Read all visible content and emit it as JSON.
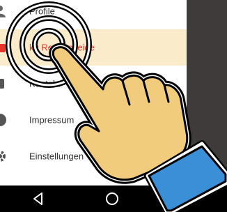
{
  "drawer": {
    "items": [
      {
        "label": "Profile",
        "icon": "profile-icon",
        "active": false
      },
      {
        "label": "kg Rest Anzeige",
        "icon": "scale-icon",
        "active": true
      },
      {
        "label": "Kontakt",
        "icon": "contact-icon",
        "active": false
      },
      {
        "label": "Impressum",
        "icon": "info-icon",
        "active": false
      },
      {
        "label": "Einstellungen",
        "icon": "gear-icon",
        "active": false
      }
    ]
  },
  "navbar": {
    "buttons": [
      "back-icon",
      "home-icon",
      "recents-icon"
    ]
  },
  "colors": {
    "active_bg": "#faeccb",
    "active_text": "#e8332a",
    "text": "#333333",
    "hand_fill": "#f0cc7c",
    "cuff": "#3b8fd6",
    "navbar": "#000000",
    "backdrop": "#3f3b3a"
  },
  "overlay": {
    "gesture": "tap-gesture",
    "ripple_icon": "tap-ripple-icon",
    "hand_icon": "pointing-hand-icon"
  }
}
